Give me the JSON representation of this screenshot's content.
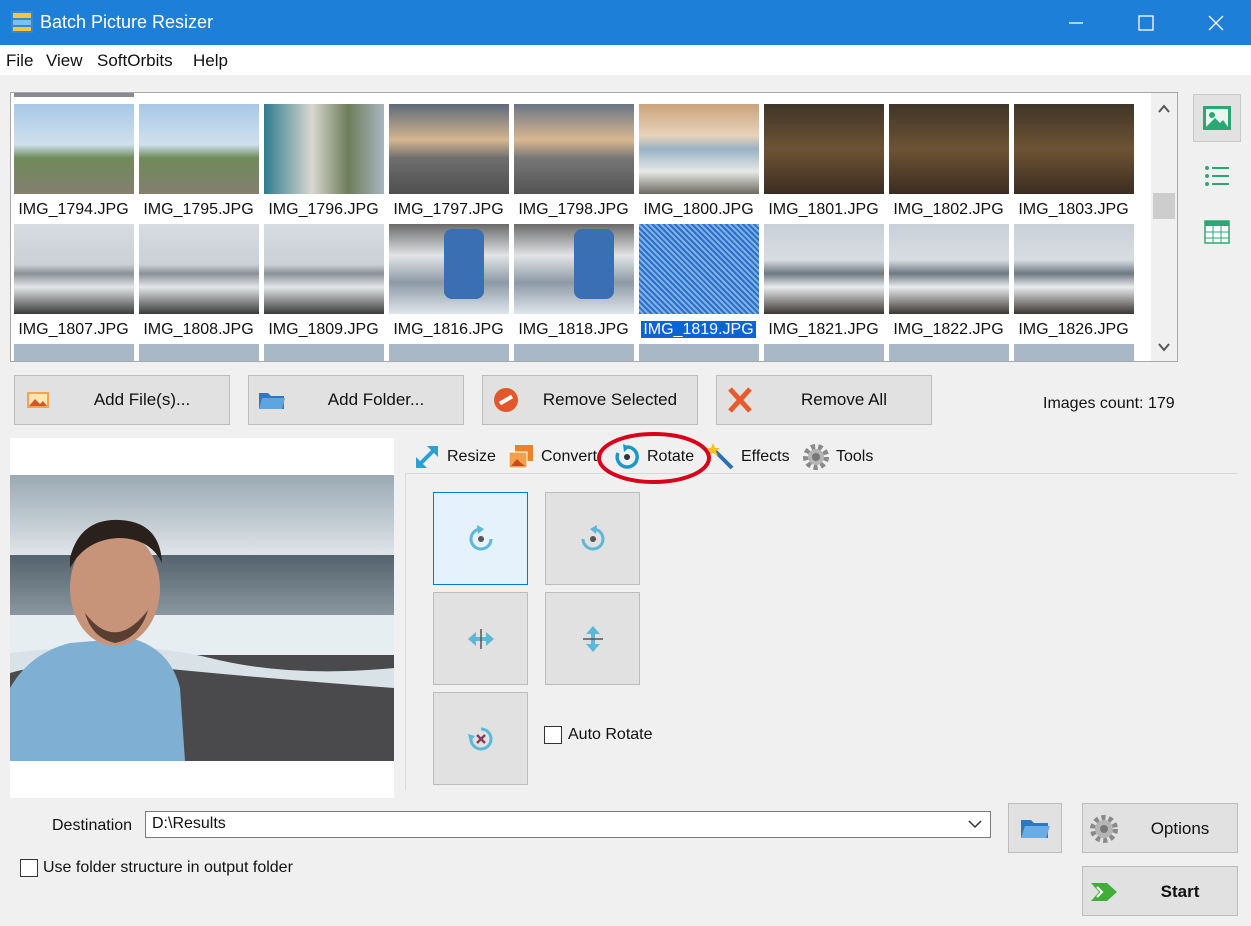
{
  "window": {
    "title": "Batch Picture Resizer",
    "accent_color": "#1e7fd8"
  },
  "menu": {
    "items": [
      {
        "label": "File"
      },
      {
        "label": "View"
      },
      {
        "label": "SoftOrbits"
      },
      {
        "label": "Help"
      }
    ]
  },
  "thumbnails": {
    "row1": [
      {
        "name": "IMG_1794.JPG"
      },
      {
        "name": "IMG_1795.JPG"
      },
      {
        "name": "IMG_1796.JPG"
      },
      {
        "name": "IMG_1797.JPG"
      },
      {
        "name": "IMG_1798.JPG"
      },
      {
        "name": "IMG_1800.JPG"
      },
      {
        "name": "IMG_1801.JPG"
      },
      {
        "name": "IMG_1802.JPG"
      },
      {
        "name": "IMG_1803.JPG"
      }
    ],
    "row2": [
      {
        "name": "IMG_1807.JPG"
      },
      {
        "name": "IMG_1808.JPG"
      },
      {
        "name": "IMG_1809.JPG"
      },
      {
        "name": "IMG_1816.JPG"
      },
      {
        "name": "IMG_1818.JPG"
      },
      {
        "name": "IMG_1819.JPG",
        "selected": true
      },
      {
        "name": "IMG_1821.JPG"
      },
      {
        "name": "IMG_1822.JPG"
      },
      {
        "name": "IMG_1826.JPG"
      }
    ],
    "selection_color": "#0a64d2"
  },
  "view_toggles": [
    {
      "icon": "thumbnail-view-icon",
      "active": true
    },
    {
      "icon": "list-view-icon",
      "active": false
    },
    {
      "icon": "table-view-icon",
      "active": false
    }
  ],
  "actions": {
    "add_files": "Add File(s)...",
    "add_folder": "Add Folder...",
    "remove_selected": "Remove Selected",
    "remove_all": "Remove All"
  },
  "images_count": "Images count: 179",
  "tabs": [
    {
      "label": "Resize",
      "icon": "resize-icon"
    },
    {
      "label": "Convert",
      "icon": "convert-icon"
    },
    {
      "label": "Rotate",
      "icon": "rotate-icon",
      "active": true
    },
    {
      "label": "Effects",
      "icon": "effects-wand-icon"
    },
    {
      "label": "Tools",
      "icon": "tools-gear-icon"
    }
  ],
  "rotate": {
    "buttons": [
      {
        "icon": "rotate-left-icon",
        "active": true
      },
      {
        "icon": "rotate-right-icon"
      },
      {
        "icon": "flip-horizontal-icon"
      },
      {
        "icon": "flip-vertical-icon"
      },
      {
        "icon": "rotate-reset-icon"
      }
    ],
    "auto_rotate_label": "Auto Rotate",
    "auto_rotate_checked": false
  },
  "destination": {
    "label": "Destination",
    "value": "D:\\Results"
  },
  "folder_structure_label": "Use folder structure in output folder",
  "folder_structure_checked": false,
  "options_label": "Options",
  "start_label": "Start",
  "annotation_color": "#d9001b"
}
